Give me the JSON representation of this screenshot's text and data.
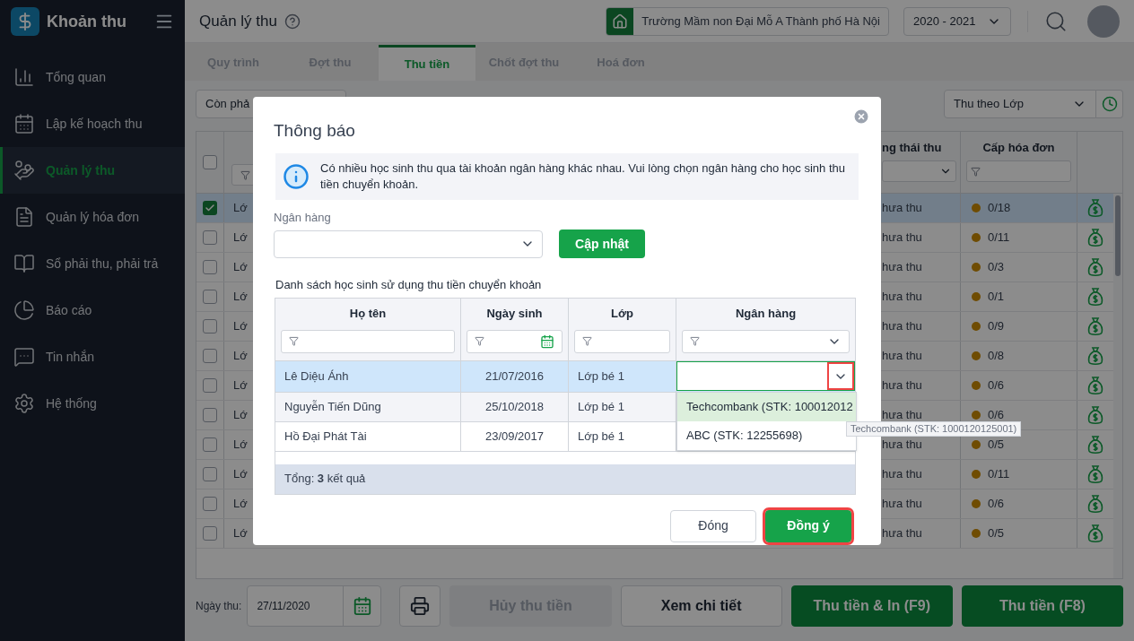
{
  "sidebar": {
    "app_title": "Khoản thu",
    "items": [
      {
        "label": "Tổng quan",
        "selected": false
      },
      {
        "label": "Lập kế hoạch thu",
        "selected": false
      },
      {
        "label": "Quản lý thu",
        "selected": true
      },
      {
        "label": "Quản lý hóa đơn",
        "selected": false
      },
      {
        "label": "Sổ phải thu, phải trả",
        "selected": false
      },
      {
        "label": "Báo cáo",
        "selected": false
      },
      {
        "label": "Tin nhắn",
        "selected": false
      },
      {
        "label": "Hệ thống",
        "selected": false
      }
    ]
  },
  "header": {
    "title": "Quản lý thu",
    "school": "Trường Mầm non Đại Mỗ A Thành phố Hà Nội",
    "year": "2020 - 2021"
  },
  "tabs": [
    {
      "label": "Quy trình",
      "selected": false
    },
    {
      "label": "Đợt thu",
      "selected": false
    },
    {
      "label": "Thu tiền",
      "selected": true
    },
    {
      "label": "Chốt đợt thu",
      "selected": false
    },
    {
      "label": "Hoá đơn",
      "selected": false
    }
  ],
  "toolbar": {
    "filter": "Còn phả",
    "mode": "Thu theo Lớp"
  },
  "table": {
    "all_checked": false,
    "columns": [
      "ng thái thu",
      "Cấp hóa đơn"
    ],
    "rows": [
      {
        "selected": true,
        "class": "Lớ",
        "status": "hưa thu",
        "invoice": "0/18"
      },
      {
        "selected": false,
        "class": "Lớ",
        "status": "hưa thu",
        "invoice": "0/11"
      },
      {
        "selected": false,
        "class": "Lớ",
        "status": "hưa thu",
        "invoice": "0/3"
      },
      {
        "selected": false,
        "class": "Lớ",
        "status": "hưa thu",
        "invoice": "0/1"
      },
      {
        "selected": false,
        "class": "Lớ",
        "status": "hưa thu",
        "invoice": "0/9"
      },
      {
        "selected": false,
        "class": "Lớ",
        "status": "hưa thu",
        "invoice": "0/8"
      },
      {
        "selected": false,
        "class": "Lớ",
        "status": "hưa thu",
        "invoice": "0/6"
      },
      {
        "selected": false,
        "class": "Lớ",
        "status": "hưa thu",
        "invoice": "0/6"
      },
      {
        "selected": false,
        "class": "Lớ",
        "status": "hưa thu",
        "invoice": "0/5"
      },
      {
        "selected": false,
        "class": "Lớ",
        "status": "hưa thu",
        "invoice": "0/11"
      },
      {
        "selected": false,
        "class": "Lớ",
        "status": "hưa thu",
        "invoice": "0/6"
      },
      {
        "selected": false,
        "class": "Lớ",
        "status": "hưa thu",
        "invoice": "0/5"
      }
    ]
  },
  "footer": {
    "date_label": "Ngày thu:",
    "date": "27/11/2020",
    "buttons": [
      {
        "label": "Hủy thu tiền",
        "kind": "disabled"
      },
      {
        "label": "Xem chi tiết",
        "kind": "secondary"
      },
      {
        "label": "Thu tiền & In (F9)",
        "kind": "primary"
      },
      {
        "label": "Thu tiền (F8)",
        "kind": "primary"
      }
    ]
  },
  "dialog": {
    "title": "Thông báo",
    "message": "Có nhiều học sinh thu qua tài khoản ngân hàng khác nhau. Vui lòng chọn ngân hàng cho học sinh thu tiền chuyển khoản.",
    "bank_label": "Ngân hàng",
    "update_button": "Cập nhật",
    "list_label": "Danh sách học sinh sử dụng thu tiền chuyển khoản",
    "columns": [
      "Họ tên",
      "Ngày sinh",
      "Lớp",
      "Ngân hàng"
    ],
    "rows": [
      {
        "name": "Lê Diệu Ánh",
        "dob": "21/07/2016",
        "class": "Lớp bé 1",
        "selected": true,
        "editing": true
      },
      {
        "name": "Nguyễn Tiến Dũng",
        "dob": "25/10/2018",
        "class": "Lớp bé 1",
        "selected": false,
        "editing": false
      },
      {
        "name": "Hồ Đại Phát Tài",
        "dob": "23/09/2017",
        "class": "Lớp bé 1",
        "selected": false,
        "editing": false
      }
    ],
    "dropdown": {
      "highlighted": true,
      "options": [
        {
          "label": "Techcombank (STK: 100012012",
          "selected": true
        },
        {
          "label": "ABC (STK: 12255698)",
          "selected": false
        }
      ]
    },
    "total": "Tổng: **3** kết quả",
    "buttons": [
      {
        "label": "Đóng",
        "kind": "secondary",
        "highlighted": false
      },
      {
        "label": "Đồng ý",
        "kind": "primary",
        "highlighted": true
      }
    ]
  },
  "tooltip": {
    "text": "Techcombank (STK: 1000120125001)"
  }
}
